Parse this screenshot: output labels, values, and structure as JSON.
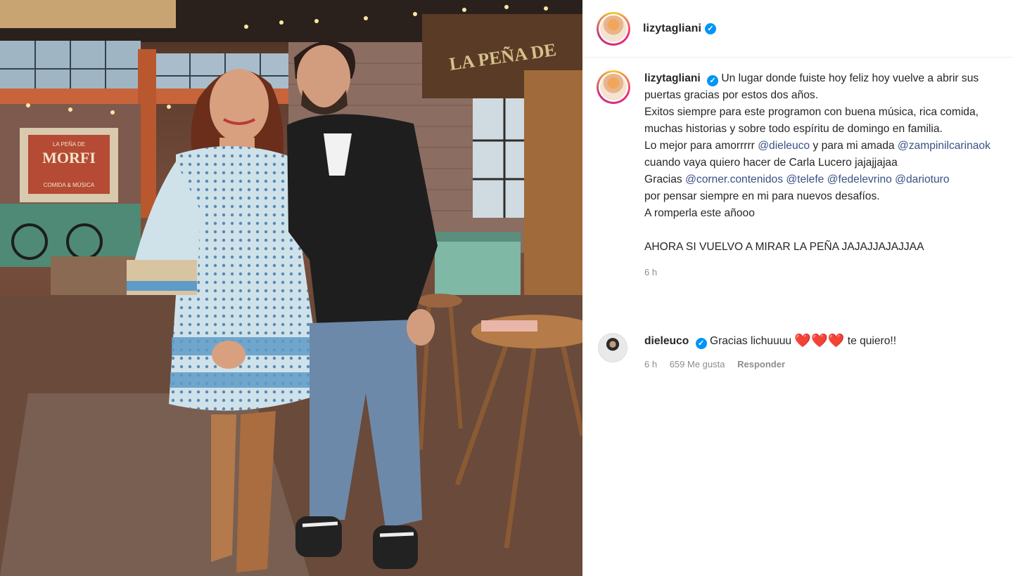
{
  "post": {
    "username": "lizytagliani",
    "verified_mark": "✓"
  },
  "photo": {
    "sign_line1": "LA PEÑA DE",
    "sign_line2": "MORFI",
    "sign_line3": "COMIDA & MÚSICA",
    "header_sign": "LA PEÑA DE"
  },
  "caption": {
    "username": "lizytagliani",
    "line1": " Un lugar donde fuiste hoy feliz hoy vuelve a abrir sus puertas gracias por estos dos años.",
    "line2": "Exitos siempre para este programon con buena música, rica comida, muchas historias y sobre todo espíritu de domingo en familia.",
    "line3_pre": "Lo mejor para amorrrrr ",
    "mention1": "@dieleuco",
    "line3_mid": " y para mi amada ",
    "mention2": "@zampinilcarinaok",
    "line3_post": " cuando vaya quiero hacer de Carla Lucero jajajjajaa",
    "line4_pre": "Gracias ",
    "mention3": "@corner.contenidos",
    "mention4": "@telefe",
    "mention5": "@fedelevrino",
    "mention6": "@darioturo",
    "line4_post": "por pensar siempre en mi para nuevos desafíos.",
    "line5": "A romperla este añooo",
    "line6": "AHORA SI VUELVO A MIRAR LA PEÑA JAJAJJAJAJJAA",
    "time": "6 h"
  },
  "comment": {
    "username": "dieleuco",
    "text_pre": " Gracias lichuuuu ",
    "hearts": "❤️❤️❤️",
    "text_post": " te quiero!!",
    "time": "6 h",
    "likes": "659 Me gusta",
    "reply_label": "Responder"
  }
}
